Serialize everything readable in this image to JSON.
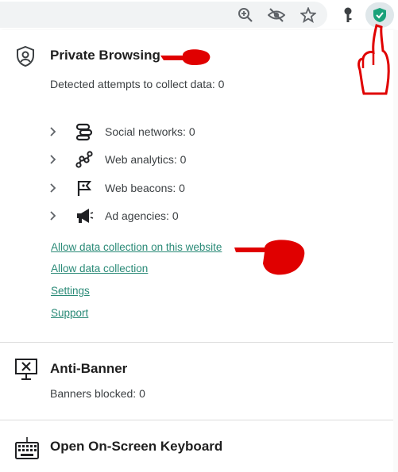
{
  "browser": {
    "toolbar_icons": [
      "zoom-icon",
      "eye-off-icon",
      "star-icon",
      "key-icon",
      "kaspersky-shield-icon"
    ]
  },
  "private_browsing": {
    "title": "Private Browsing",
    "detected": "Detected attempts to collect data: 0",
    "categories": [
      {
        "label": "Social networks: 0",
        "icon": "social-networks-icon"
      },
      {
        "label": "Web analytics: 0",
        "icon": "web-analytics-icon"
      },
      {
        "label": "Web beacons: 0",
        "icon": "web-beacons-icon"
      },
      {
        "label": "Ad agencies: 0",
        "icon": "ad-agencies-icon"
      }
    ],
    "links": {
      "allow_site": "Allow data collection on this website",
      "allow_all": "Allow data collection",
      "settings": "Settings",
      "support": "Support"
    }
  },
  "anti_banner": {
    "title": "Anti-Banner",
    "blocked": "Banners blocked: 0"
  },
  "keyboard": {
    "title": "Open On-Screen Keyboard"
  },
  "colors": {
    "link": "#2a8a77",
    "accent_shield": "#1aa27a",
    "annotation": "#e00000"
  }
}
